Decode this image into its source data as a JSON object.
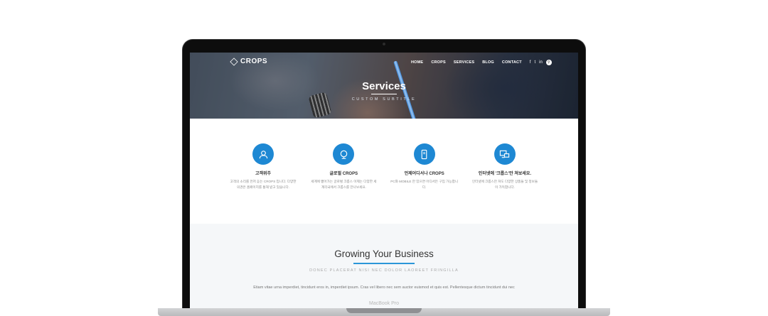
{
  "device": {
    "label": "MacBook Pro"
  },
  "site": {
    "logo": "CROPS",
    "nav": [
      "HOME",
      "CROPS",
      "SERVICES",
      "BLOG",
      "CONTACT"
    ],
    "social": [
      "f",
      "t",
      "in"
    ],
    "hero": {
      "title": "Services",
      "subtitle": "CUSTOM SUBTITLE"
    }
  },
  "features": [
    {
      "icon": "user-icon",
      "title": "고객위주",
      "text": "고객의 소리를 먼저 듣는 CROPS 입니다. 다양한 의견은 홈페이지를 통해 받고 있습니다."
    },
    {
      "icon": "globe-icon",
      "title": "글로벌 CROPS",
      "text": "세계에 뻗어가는 글로벌 크롭스 이제는 다양한 세계각국에서 크롭스를 만나보세요."
    },
    {
      "icon": "mobile-icon",
      "title": "언제어디서나 CROPS",
      "text": "PC와 MOBILE 만 있으면 어디서든 구입 가능합니다."
    },
    {
      "icon": "monitor-icon",
      "title": "인터넷에 '크롭스'만 쳐보세요.",
      "text": "인터넷에 크롭스만 쳐도 다양한 상품들 및 정보들이 가득합니다."
    }
  ],
  "growing": {
    "title": "Growing Your Business",
    "subtitle": "DONEC PLACERAT NISI NEC DOLOR LAOREET FRINGILLA",
    "body": "Etiam vitae urna imperdiet, tincidunt eros in, imperdiet ipsum. Cras vel libero nec sem auctor euismod et quis est. Pellentesque dictum tincidunt dui nec"
  },
  "colors": {
    "accent": "#1e88d3",
    "frame": "#0d0d0d",
    "base": "#c6c7c9"
  }
}
